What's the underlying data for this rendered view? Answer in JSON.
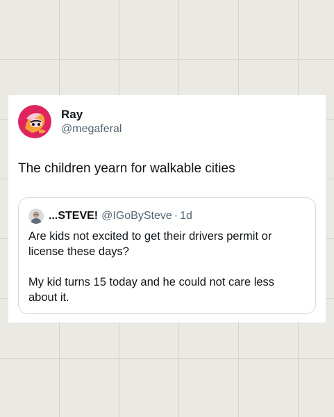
{
  "tweet": {
    "author": {
      "name": "Ray",
      "handle": "@megaferal",
      "avatar_icon": "cartoon-avatar-icon"
    },
    "text": "The children yearn for walkable cities",
    "quoted": {
      "author": {
        "name": "...STEVE!",
        "handle": "@IGoBySteve",
        "avatar_icon": "person-photo-avatar-icon"
      },
      "separator": "·",
      "time": "1d",
      "paragraphs": [
        "Are kids not excited to get their drivers permit or license these days?",
        "My kid turns 15 today and he could not care less about it."
      ]
    }
  },
  "colors": {
    "background": "#ebe9e4",
    "grid_line": "#d4d2cd",
    "card": "#ffffff",
    "text_primary": "#0f1419",
    "text_secondary": "#536471",
    "quote_border": "#cfd9de",
    "avatar_accent": "#e0245e"
  }
}
